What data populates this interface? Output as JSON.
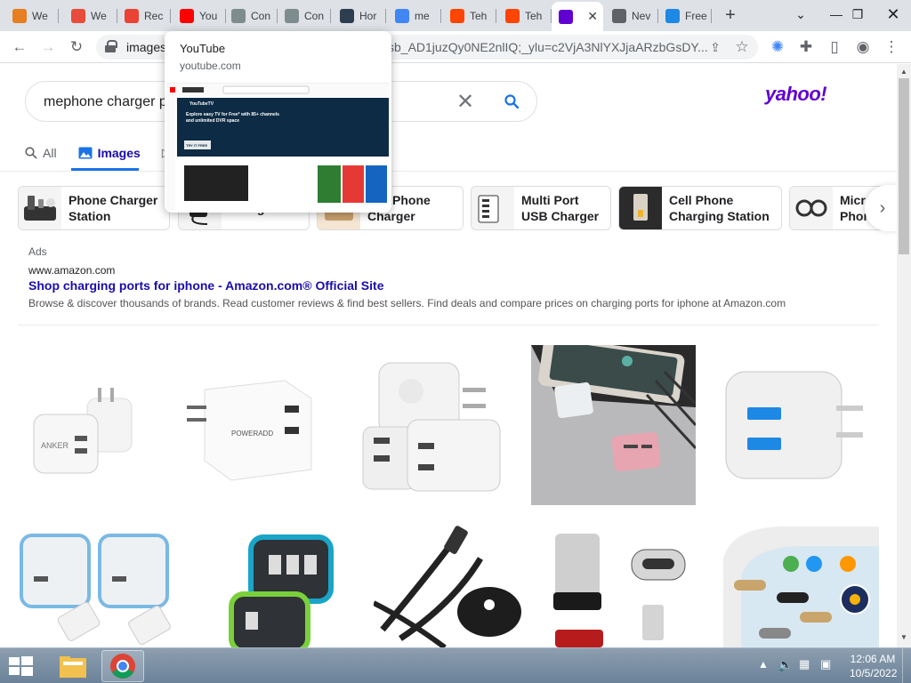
{
  "browser": {
    "tabs": [
      {
        "label": "We",
        "favicon_color": "#e67e22",
        "favicon": "edit-icon"
      },
      {
        "label": "We",
        "favicon_color": "#e74c3c",
        "favicon": "photo-icon"
      },
      {
        "label": "Rec",
        "favicon_color": "#ea4335",
        "favicon": "record-icon"
      },
      {
        "label": "You",
        "favicon_color": "#ff0000",
        "favicon": "youtube-icon"
      },
      {
        "label": "Con",
        "favicon_color": "#7f8c8d",
        "favicon": "owl-icon"
      },
      {
        "label": "Con",
        "favicon_color": "#7f8c8d",
        "favicon": "owl-icon"
      },
      {
        "label": "Hor",
        "favicon_color": "#2c3e50",
        "favicon": "globe-icon"
      },
      {
        "label": "me",
        "favicon_color": "#4285f4",
        "favicon": "google-icon"
      },
      {
        "label": "Teh",
        "favicon_color": "#ff4500",
        "favicon": "reddit-icon"
      },
      {
        "label": "Teh",
        "favicon_color": "#ff4500",
        "favicon": "reddit-icon"
      },
      {
        "label": "",
        "favicon_color": "#6001d2",
        "favicon": "yahoo-icon",
        "active": true
      },
      {
        "label": "Nev",
        "favicon_color": "#5f6368",
        "favicon": "chrome-icon"
      },
      {
        "label": "Free",
        "favicon_color": "#1e88e5",
        "favicon": "fs-icon"
      }
    ],
    "new_tab_label": "+",
    "address": {
      "prefix": "images",
      "rest": "sb_AD1juzQy0NE2nlIQ;_ylu=c2VjA3NlYXJjaARzbGsDY..."
    },
    "hover_card": {
      "title": "YouTube",
      "domain": "youtube.com",
      "preview_banner_brand": "YouTubeTV",
      "preview_banner_text": "Explore easy TV for Free* with 85+ channels and unlimited DVR space",
      "preview_button": "TRY IT FREE"
    }
  },
  "search": {
    "query": "mephone charger p",
    "logo": "yahoo!",
    "filters": [
      {
        "label": "All",
        "icon": "search-icon"
      },
      {
        "label": "Images",
        "icon": "image-icon",
        "active": true
      },
      {
        "label": "",
        "icon": "play-icon"
      }
    ]
  },
  "chips": [
    {
      "label": "Phone Charger\nStation"
    },
    {
      "label": "Charger"
    },
    {
      "label": "bile Phone\nCharger"
    },
    {
      "label": "Multi Port\nUSB Charger"
    },
    {
      "label": "Cell Phone\nCharging Station"
    },
    {
      "label": "Micr\nPhon"
    }
  ],
  "ad": {
    "label": "Ads",
    "url": "www.amazon.com",
    "title": "Shop charging ports for iphone - Amazon.com® Official Site",
    "description": "Browse & discover thousands of brands. Read customer reviews & find best sellers. Find deals and compare prices on charging ports for iphone at Amazon.com"
  },
  "image_brand_texts": {
    "anker": "ANKER",
    "poweradd": "POWERADD"
  },
  "taskbar": {
    "time": "12:06 AM",
    "date": "10/5/2022"
  }
}
